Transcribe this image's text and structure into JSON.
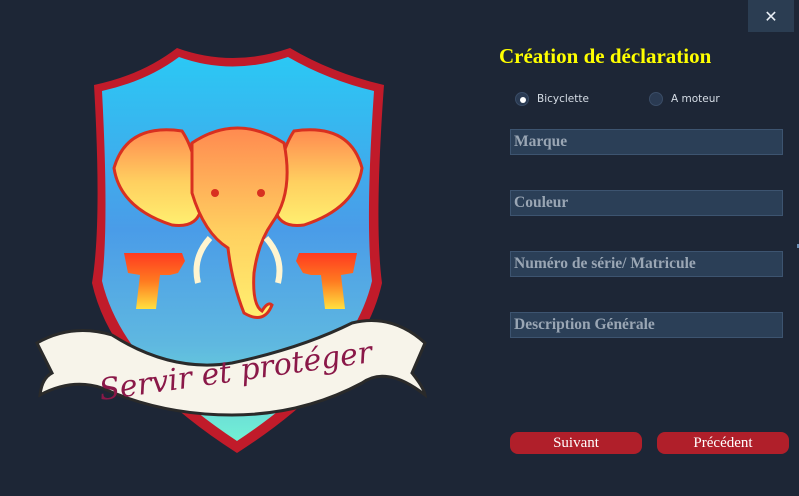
{
  "window": {
    "close_icon": "close-icon",
    "close_glyph": "✕"
  },
  "logo": {
    "motto": "Servir et protéger"
  },
  "form": {
    "title": "Création de déclaration",
    "vehicle_type": {
      "options": [
        {
          "label": "Bicyclette",
          "checked": true
        },
        {
          "label": "A moteur",
          "checked": false
        }
      ]
    },
    "fields": {
      "brand_placeholder": "Marque",
      "color_placeholder": "Couleur",
      "serial_placeholder": "Numéro de série/ Matricule",
      "description_placeholder": "Description Générale"
    },
    "buttons": {
      "next": "Suivant",
      "previous": "Précédent"
    }
  },
  "colors": {
    "background": "#1d2636",
    "title": "#ffff00",
    "button": "#b01f2a",
    "field": "#2b3f57"
  }
}
